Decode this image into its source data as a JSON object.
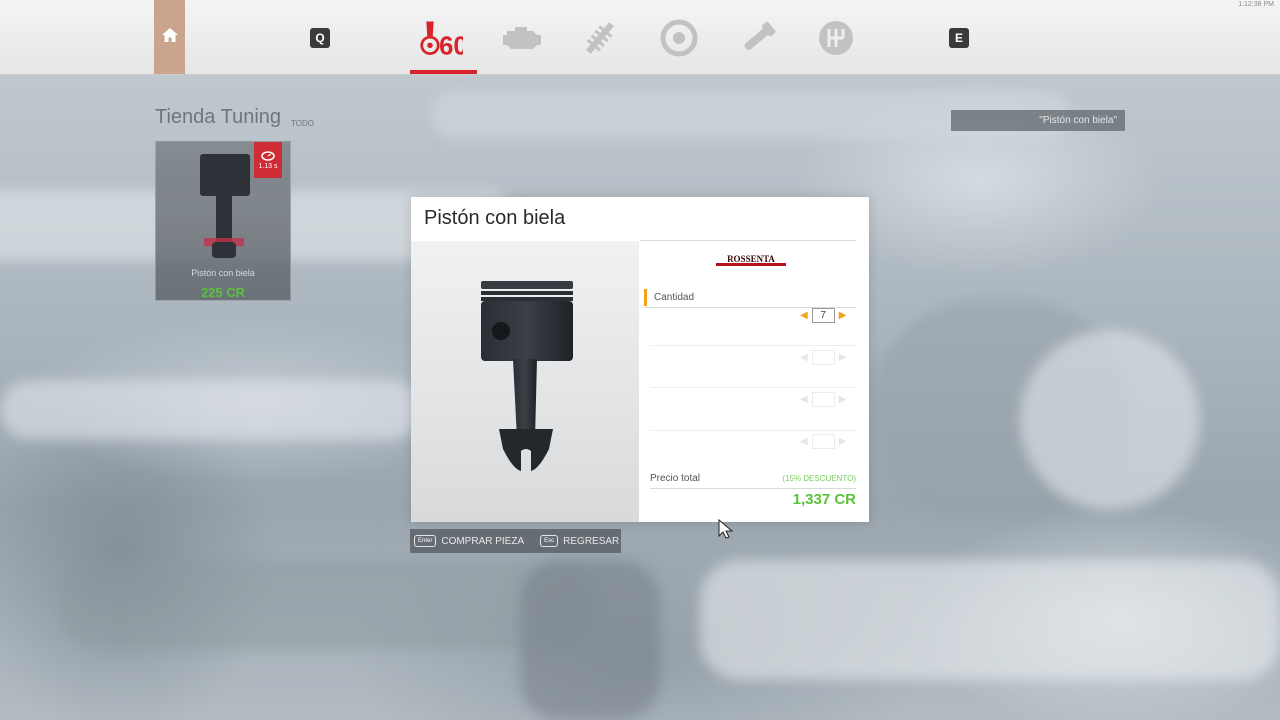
{
  "topbar": {
    "clock": "1:12:38 PM",
    "left_key": "Q",
    "right_key": "E",
    "categories": [
      {
        "name": "tuning-60-icon",
        "active": true
      },
      {
        "name": "engine-icon",
        "active": false
      },
      {
        "name": "suspension-icon",
        "active": false
      },
      {
        "name": "brakes-icon",
        "active": false
      },
      {
        "name": "exhaust-icon",
        "active": false
      },
      {
        "name": "gearbox-icon",
        "active": false
      }
    ],
    "accent_color": "#d8232a"
  },
  "shop": {
    "title": "Tienda Tuning",
    "subtitle": "TODO",
    "filter_text": "\"Pistón con biela\""
  },
  "item_card": {
    "badge_value": "1.13 s",
    "name": "Pistón con biela",
    "price": "225 CR"
  },
  "modal": {
    "title": "Pistón con biela",
    "brand": "ROSSENTA",
    "quantity_label": "Cantidad",
    "quantity_value": "7",
    "total_label": "Precio total",
    "discount_text": "(15% DESCUENTO)",
    "total_price": "1,337 CR",
    "price_color": "#5ac33a"
  },
  "actions": {
    "buy_key": "Enter",
    "buy_label": "COMPRAR PIEZA",
    "back_key": "Esc",
    "back_label": "REGRESAR"
  }
}
